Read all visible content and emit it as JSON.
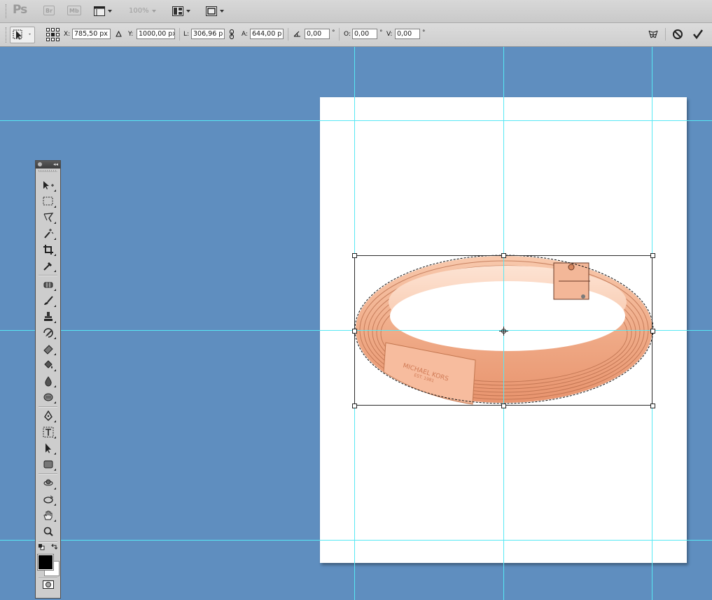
{
  "app": {
    "logo": "Ps",
    "bridge_label": "Br",
    "minibridge_label": "Mb",
    "zoom": "100%"
  },
  "options": {
    "x_label": "X:",
    "x_value": "785,50 px",
    "y_label": "Y:",
    "y_value": "1000,00 px",
    "w_label": "L:",
    "w_value": "306,96 p",
    "h_label": "A:",
    "h_value": "644,00 p",
    "angle_value": "0,00",
    "angle_unit": "°",
    "hskew_label": "O:",
    "hskew_value": "0,00",
    "vskew_label": "V:",
    "vskew_value": "0,00"
  },
  "image": {
    "brand_text": "MICHAEL KORS",
    "est_text": "EST. 1981"
  },
  "colors": {
    "canvas_bg": "#5f8ebf",
    "guide": "#57e8f4",
    "bracelet": "#f5b796"
  },
  "icons": [
    "move-icon",
    "marquee-icon",
    "lasso-icon",
    "magic-wand-icon",
    "crop-icon",
    "eyedropper-icon",
    "healing-brush-icon",
    "brush-icon",
    "clone-stamp-icon",
    "history-brush-icon",
    "eraser-icon",
    "paint-bucket-icon",
    "blur-icon",
    "dodge-icon",
    "pen-icon",
    "type-icon",
    "path-selection-icon",
    "shape-icon",
    "3d-rotate-icon",
    "3d-orbit-icon",
    "hand-icon",
    "zoom-icon"
  ]
}
